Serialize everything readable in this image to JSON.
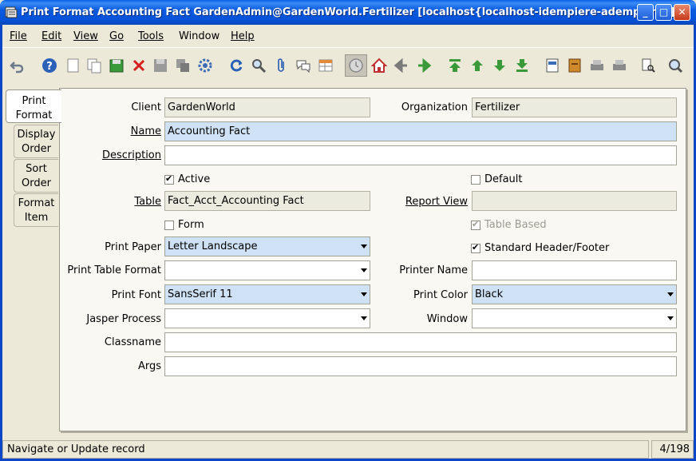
{
  "window": {
    "title": "Print Format  Accounting Fact  GardenAdmin@GardenWorld.Fertilizer [localhost{localhost-idempiere-adempiere}]",
    "minimize": "_",
    "maximize": "□",
    "close": "✕"
  },
  "menu": {
    "file": "File",
    "edit": "Edit",
    "view": "View",
    "go": "Go",
    "tools": "Tools",
    "window": "Window",
    "help": "Help"
  },
  "tabs": [
    {
      "label": "Print Format"
    },
    {
      "label": "Display Order"
    },
    {
      "label": "Sort Order"
    },
    {
      "label": "Format Item"
    }
  ],
  "form": {
    "client_label": "Client",
    "client_value": "GardenWorld",
    "org_label": "Organization",
    "org_value": "Fertilizer",
    "name_label": "Name",
    "name_value": "Accounting Fact",
    "description_label": "Description",
    "description_value": "",
    "active_label": "Active",
    "active_checked": true,
    "default_label": "Default",
    "default_checked": false,
    "table_label": "Table",
    "table_value": "Fact_Acct_Accounting Fact",
    "report_view_label": "Report View",
    "report_view_value": "",
    "form_label": "Form",
    "form_checked": false,
    "table_based_label": "Table Based",
    "table_based_checked": true,
    "print_paper_label": "Print Paper",
    "print_paper_value": "Letter Landscape",
    "std_header_label": "Standard Header/Footer",
    "std_header_checked": true,
    "print_table_format_label": "Print Table Format",
    "print_table_format_value": "",
    "printer_name_label": "Printer Name",
    "printer_name_value": "",
    "print_font_label": "Print Font",
    "print_font_value": "SansSerif 11",
    "print_color_label": "Print Color",
    "print_color_value": "Black",
    "jasper_label": "Jasper Process",
    "jasper_value": "",
    "window_label": "Window",
    "window_value": "",
    "classname_label": "Classname",
    "classname_value": "",
    "args_label": "Args",
    "args_value": ""
  },
  "status": {
    "message": "Navigate or Update record",
    "record_count": "4/198"
  },
  "colors": {
    "title_bar": "#0552d8",
    "mandatory_field": "#cfe1f4",
    "readonly_field": "#ecebdf",
    "window_bg": "#ece9d8"
  },
  "toolbar_icons": [
    "undo-icon",
    "help-icon",
    "new-record-icon",
    "copy-record-icon",
    "save-green-icon",
    "delete-icon",
    "save-icon",
    "delete-selection-icon",
    "settings-icon",
    "refresh-icon",
    "find-icon",
    "attachment-icon",
    "chat-icon",
    "grid-toggle-icon",
    "history-icon",
    "home-icon",
    "back-icon",
    "forward-icon",
    "first-record-icon",
    "previous-record-icon",
    "next-record-icon",
    "last-record-icon",
    "report-icon",
    "archive-icon",
    "print-preview-icon",
    "print-icon",
    "zoom-across-icon",
    "request-icon"
  ]
}
